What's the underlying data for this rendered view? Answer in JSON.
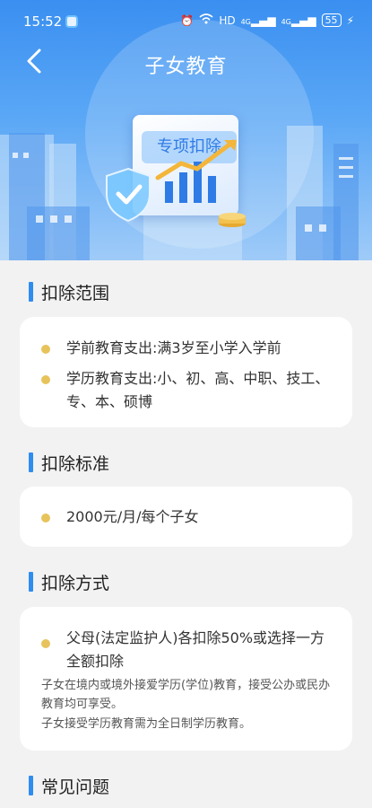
{
  "status_bar": {
    "time": "15:52",
    "network": "HD",
    "signal_1": "4G",
    "signal_2": "4G",
    "battery": "55"
  },
  "header": {
    "title": "子女教育",
    "banner_badge": "专项扣除"
  },
  "sections": {
    "scope": {
      "title": "扣除范围",
      "items": [
        "学前教育支出:满3岁至小学入学前",
        "学历教育支出:小、初、高、中职、技工、专、本、硕博"
      ]
    },
    "standard": {
      "title": "扣除标准",
      "items": [
        "2000元/月/每个子女"
      ]
    },
    "method": {
      "title": "扣除方式",
      "items": [
        "父母(法定监护人)各扣除50%或选择一方全额扣除"
      ],
      "notes": [
        "子女在境内或境外接爱学历(学位)教育，接受公办或民办教育均可享受。",
        "子女接受学历教育需为全日制学历教育。"
      ]
    },
    "faq": {
      "title": "常见问题"
    }
  },
  "colors": {
    "accent": "#2f8cf0",
    "bullet": "#e7c35b",
    "hero_top": "#3a8ff0"
  }
}
